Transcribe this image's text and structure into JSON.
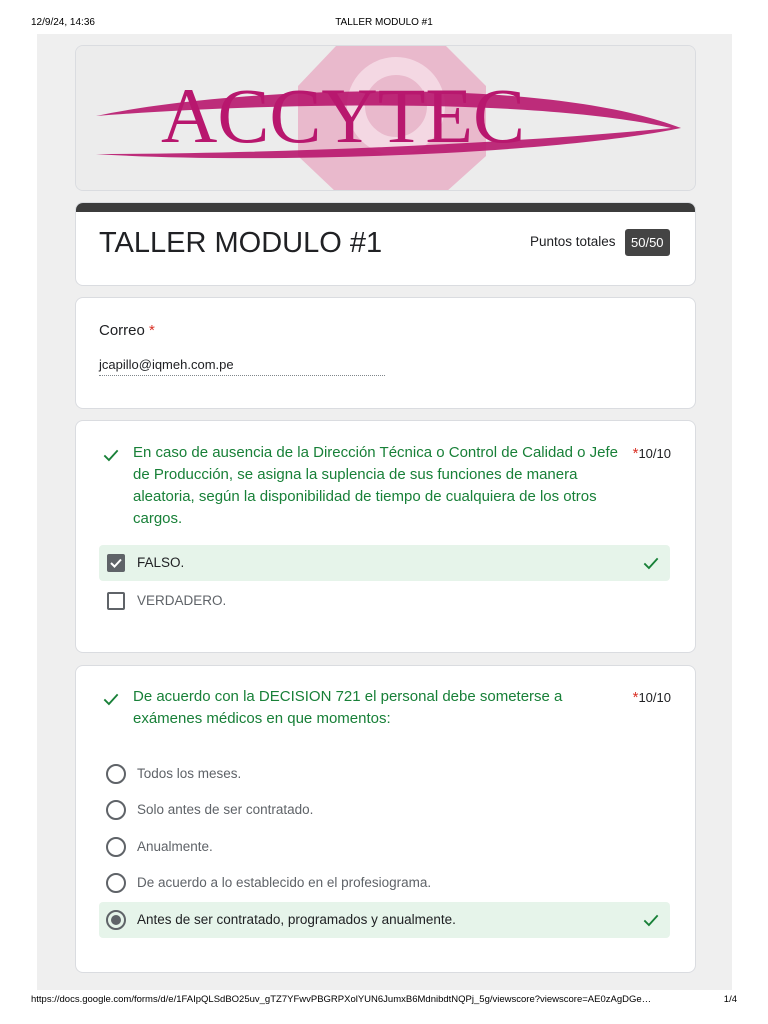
{
  "print_header": {
    "datetime": "12/9/24, 14:36",
    "title": "TALLER MODULO #1"
  },
  "print_footer": {
    "url": "https://docs.google.com/forms/d/e/1FAIpQLSdBO25uv_gTZ7YFwvPBGRPXolYUN6JumxB6MdnibdtNQPj_5g/viewscore?viewscore=AE0zAgDGe…",
    "page": "1/4"
  },
  "banner": {
    "logo_text": "ACCYTEC"
  },
  "form": {
    "title": "TALLER MODULO #1",
    "points_label": "Puntos totales",
    "points_value": "50/50"
  },
  "email": {
    "label": "Correo",
    "required_mark": "*",
    "value": "jcapillo@iqmeh.com.pe"
  },
  "questions": [
    {
      "text": "En caso de ausencia de la Dirección Técnica o Control de Calidad o Jefe de Producción, se asigna la suplencia de sus funciones de manera aleatoria, según la disponibilidad de tiempo de cualquiera de los otros cargos.",
      "required_mark": "*",
      "score": "10/10",
      "options": [
        "FALSO.",
        "VERDADERO."
      ],
      "selected": 0
    },
    {
      "text": "De acuerdo con la DECISION 721 el personal debe someterse a exámenes médicos en que momentos:",
      "required_mark": "*",
      "score": "10/10",
      "options": [
        "Todos los meses.",
        "Solo antes de ser contratado.",
        "Anualmente.",
        "De acuerdo a lo establecido en el profesiograma.",
        "Antes de ser contratado, programados y anualmente."
      ],
      "selected": 4
    }
  ],
  "colors": {
    "correct_green": "#188038",
    "selected_bg": "#e6f4ea",
    "required_red": "#d93025",
    "logo_magenta": "#b8176e"
  }
}
